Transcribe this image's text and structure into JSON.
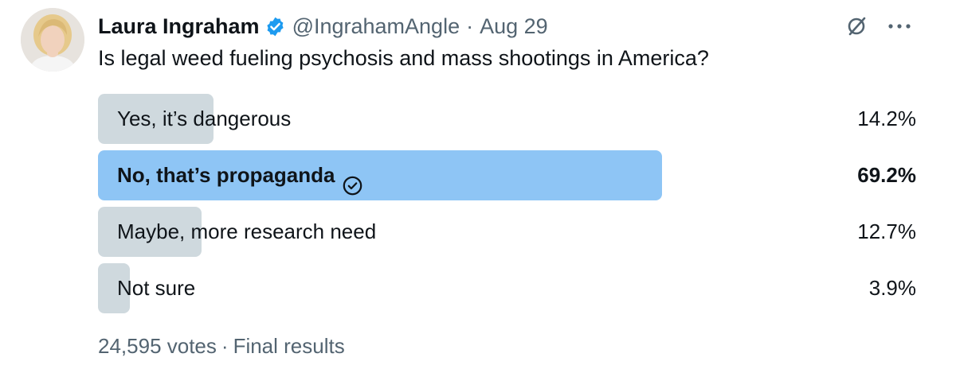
{
  "author": {
    "display_name": "Laura Ingraham",
    "handle": "@IngrahamAngle",
    "separator": "·",
    "date": "Aug 29",
    "verified": true
  },
  "tweet": {
    "text": "Is legal weed fueling psychosis and mass shootings in America?"
  },
  "poll": {
    "options": [
      {
        "label": "Yes, it’s dangerous",
        "percent_text": "14.2%",
        "percent": 14.2,
        "winner": false
      },
      {
        "label": "No, that’s propaganda",
        "percent_text": "69.2%",
        "percent": 69.2,
        "winner": true
      },
      {
        "label": "Maybe, more research need",
        "percent_text": "12.7%",
        "percent": 12.7,
        "winner": false
      },
      {
        "label": "Not sure",
        "percent_text": "3.9%",
        "percent": 3.9,
        "winner": false
      }
    ],
    "votes": "24,595 votes",
    "separator": "·",
    "status": "Final results"
  },
  "icons": {
    "verified": "verified-badge-icon",
    "grok": "grok-icon",
    "more": "more-options-icon",
    "check": "check-circle-icon"
  },
  "colors": {
    "winner_bar": "#8ec5f5",
    "bar": "#cfd9de",
    "verified": "#1d9bf0",
    "secondary_text": "#536471"
  }
}
